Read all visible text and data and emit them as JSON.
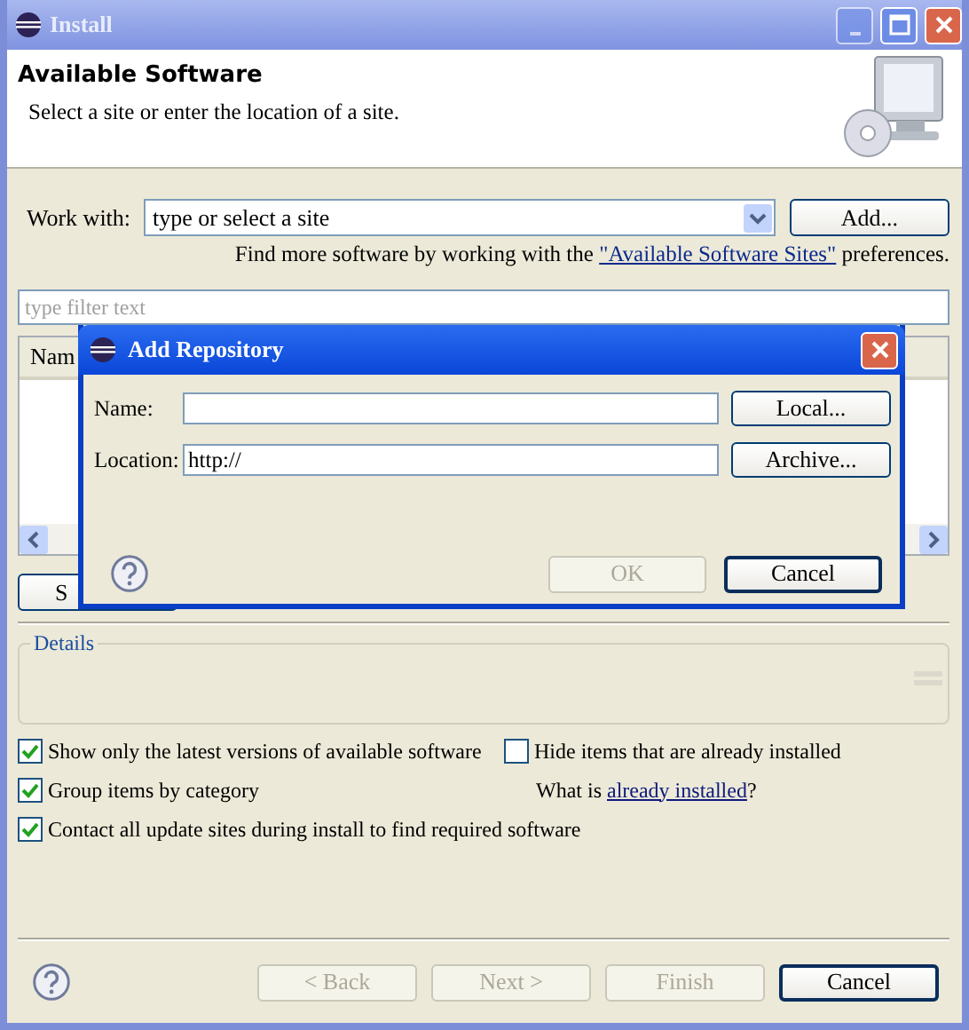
{
  "window": {
    "title": "Install"
  },
  "header": {
    "title": "Available Software",
    "subtitle": "Select a site or enter the location of a site."
  },
  "work_with": {
    "label": "Work with:",
    "value": "type or select a site",
    "button": "Add..."
  },
  "sites_note": {
    "before": "Find more software by working with the ",
    "link": "\"Available Software Sites\"",
    "after": " preferences."
  },
  "filter": {
    "placeholder": "type filter text"
  },
  "table": {
    "columns": [
      "Nam"
    ]
  },
  "table_buttons": [
    "S"
  ],
  "details": {
    "title": "Details"
  },
  "options": [
    {
      "label": "Show only the latest versions of available software",
      "checked": true
    },
    {
      "label": "Hide items that are already installed",
      "checked": false
    },
    {
      "label": "Group items by category",
      "checked": true
    },
    {
      "label": "Contact all update sites during install to find required software",
      "checked": true
    }
  ],
  "installed_note": {
    "before": "What is ",
    "link": "already installed",
    "after": "?"
  },
  "wizard_buttons": [
    {
      "label": "< Back",
      "disabled": true,
      "default": false
    },
    {
      "label": "Next >",
      "disabled": true,
      "default": false
    },
    {
      "label": "Finish",
      "disabled": true,
      "default": false
    },
    {
      "label": "Cancel",
      "disabled": false,
      "default": true
    }
  ],
  "dialog": {
    "title": "Add Repository",
    "fields": [
      {
        "label": "Name:",
        "button": "Local..."
      },
      {
        "label": "Location:",
        "value": "http://",
        "button": "Archive..."
      }
    ],
    "buttons": [
      {
        "label": "OK",
        "disabled": true,
        "default": false
      },
      {
        "label": "Cancel",
        "disabled": false,
        "default": true
      }
    ]
  }
}
